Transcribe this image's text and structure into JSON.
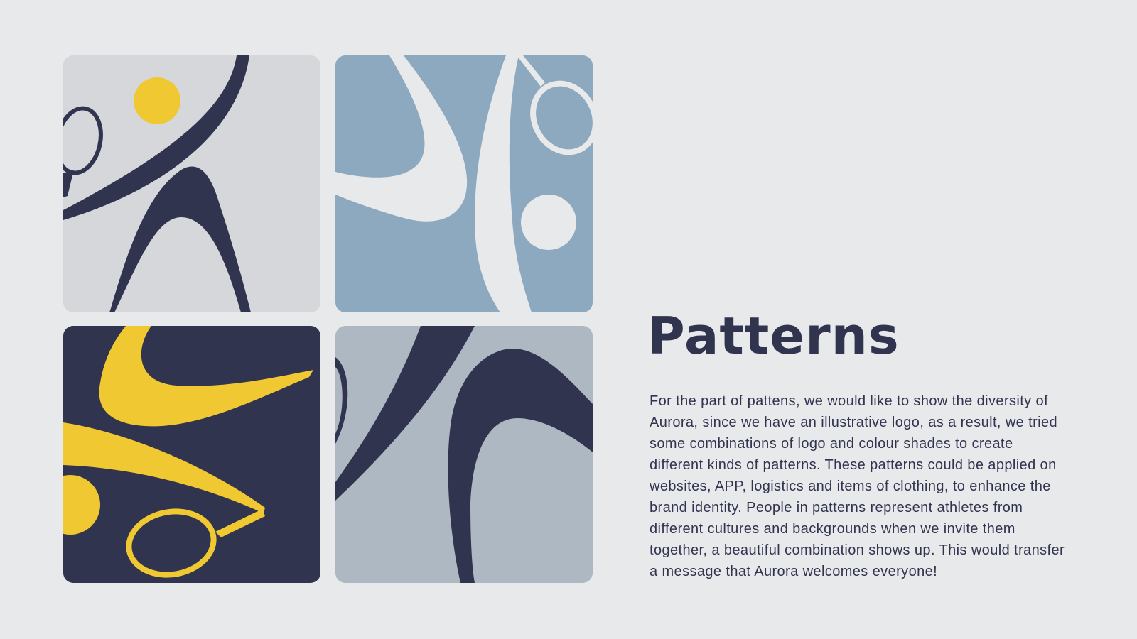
{
  "section": {
    "title": "Patterns",
    "description": "For the part of pattens, we would like to show the diversity of Aurora, since we have an illustrative logo, as a result, we tried some combinations of logo and colour shades to create different kinds of patterns. These patterns could be applied on websites, APP, logistics and items of clothing, to enhance the brand identity. People in patterns represent athletes from different cultures and backgrounds when we invite them together, a beautiful combination shows up. This would transfer a message that Aurora welcomes everyone!"
  },
  "patterns": [
    {
      "name": "pattern-navy-on-grey",
      "background": "#d5d7db",
      "figure": "#31344f",
      "accent": "#f0c832"
    },
    {
      "name": "pattern-white-on-blue",
      "background": "#8da9c0",
      "figure": "#e8e9eb",
      "accent": "#e8e9eb"
    },
    {
      "name": "pattern-yellow-on-navy",
      "background": "#31344f",
      "figure": "#f0c832",
      "accent": "#f0c832"
    },
    {
      "name": "pattern-navy-on-grey-blue",
      "background": "#aeb8c2",
      "figure": "#31344f",
      "accent": "#31344f"
    }
  ]
}
